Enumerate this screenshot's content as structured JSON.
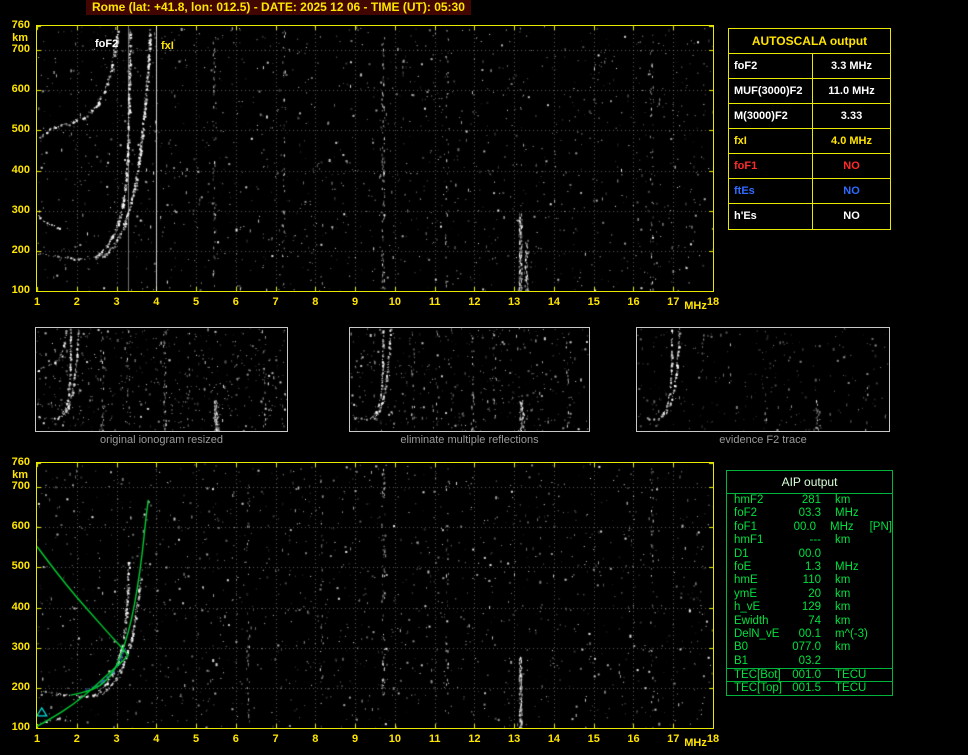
{
  "header": {
    "title": "Rome (lat: +41.8, lon: 012.5) - DATE: 2025 12 06 - TIME (UT): 05:30"
  },
  "autoscala_table": {
    "title": "AUTOSCALA output",
    "rows": [
      {
        "label": "foF2",
        "value": "3.3 MHz",
        "color": "#ffffff"
      },
      {
        "label": "MUF(3000)F2",
        "value": "11.0 MHz",
        "color": "#ffffff"
      },
      {
        "label": "M(3000)F2",
        "value": "3.33",
        "color": "#ffffff"
      },
      {
        "label": "fxI",
        "value": "4.0 MHz",
        "color": "#ffe400"
      },
      {
        "label": "foF1",
        "value": "NO",
        "color": "#ff2a2a"
      },
      {
        "label": "ftEs",
        "value": "NO",
        "color": "#2f6bff"
      },
      {
        "label": "h'Es",
        "value": "NO",
        "color": "#ffffff"
      }
    ]
  },
  "thumbnails": [
    {
      "caption": "original ionogram resized"
    },
    {
      "caption": "eliminate multiple reflections"
    },
    {
      "caption": "evidence F2 trace"
    }
  ],
  "aip_table": {
    "title": "AIP output",
    "rows": [
      {
        "name": "hmF2",
        "value": "281",
        "unit": "km",
        "extra": ""
      },
      {
        "name": "foF2",
        "value": "03.3",
        "unit": "MHz",
        "extra": ""
      },
      {
        "name": "foF1",
        "value": "00.0",
        "unit": "MHz",
        "extra": "[PN]"
      },
      {
        "name": "hmF1",
        "value": "---",
        "unit": "km",
        "extra": ""
      },
      {
        "name": "D1",
        "value": "00.0",
        "unit": "",
        "extra": ""
      },
      {
        "name": "foE",
        "value": "1.3",
        "unit": "MHz",
        "extra": ""
      },
      {
        "name": "hmE",
        "value": "110",
        "unit": "km",
        "extra": ""
      },
      {
        "name": "ymE",
        "value": "20",
        "unit": "km",
        "extra": ""
      },
      {
        "name": "h_vE",
        "value": "129",
        "unit": "km",
        "extra": ""
      },
      {
        "name": "Ewidth",
        "value": "74",
        "unit": "km",
        "extra": ""
      },
      {
        "name": "DelN_vE",
        "value": "00.1",
        "unit": "m^(-3)",
        "extra": ""
      },
      {
        "name": "B0",
        "value": "077.0",
        "unit": "km",
        "extra": ""
      },
      {
        "name": "B1",
        "value": "03.2",
        "unit": "",
        "extra": ""
      }
    ],
    "tec_rows": [
      {
        "name": "TEC[Bot]",
        "value": "001.0",
        "unit": "TECU"
      },
      {
        "name": "TEC[Top]",
        "value": "001.5",
        "unit": "TECU"
      }
    ]
  },
  "chart_data": [
    {
      "id": "scaled-ionogram",
      "type": "scatter",
      "title": "autoscaled ionogram with foF2 and fxI markers",
      "xlabel": "MHz",
      "ylabel": "km",
      "xlim": [
        1,
        18
      ],
      "ylim": [
        100,
        760
      ],
      "x_ticks": [
        1,
        2,
        3,
        4,
        5,
        6,
        7,
        8,
        9,
        10,
        11,
        12,
        13,
        14,
        15,
        16,
        17,
        18
      ],
      "y_ticks": [
        760,
        700,
        600,
        500,
        400,
        300,
        200,
        100
      ],
      "grid": true,
      "markers": [
        {
          "label": "foF2",
          "mhz": 3.3
        },
        {
          "label": "fxI",
          "mhz": 4.0
        }
      ],
      "series": [
        {
          "name": "F-trace-low",
          "points": [
            [
              1.05,
              195
            ],
            [
              1.35,
              188
            ],
            [
              1.7,
              183
            ],
            [
              2.05,
              181
            ],
            [
              2.35,
              182
            ],
            [
              2.55,
              186
            ]
          ]
        },
        {
          "name": "F-trace-onset",
          "points": [
            [
              1.0,
              292
            ],
            [
              1.15,
              276
            ],
            [
              1.35,
              265
            ],
            [
              1.55,
              259
            ]
          ]
        },
        {
          "name": "F2-ordinary",
          "points": [
            [
              2.45,
              183
            ],
            [
              2.75,
              212
            ],
            [
              2.95,
              248
            ],
            [
              3.1,
              292
            ],
            [
              3.2,
              350
            ],
            [
              3.27,
              430
            ],
            [
              3.3,
              530
            ],
            [
              3.32,
              650
            ],
            [
              3.33,
              756
            ]
          ]
        },
        {
          "name": "F2-extraordinary",
          "points": [
            [
              2.65,
              186
            ],
            [
              2.95,
              218
            ],
            [
              3.15,
              256
            ],
            [
              3.32,
              306
            ],
            [
              3.47,
              366
            ],
            [
              3.58,
              440
            ],
            [
              3.68,
              530
            ],
            [
              3.76,
              622
            ],
            [
              3.82,
              712
            ],
            [
              3.84,
              758
            ]
          ]
        },
        {
          "name": "second-reflection",
          "points": [
            [
              1.05,
              482
            ],
            [
              1.35,
              505
            ],
            [
              1.75,
              517
            ],
            [
              2.15,
              533
            ],
            [
              2.5,
              562
            ],
            [
              2.72,
              606
            ],
            [
              2.88,
              656
            ],
            [
              2.98,
              716
            ],
            [
              3.03,
              758
            ]
          ]
        }
      ],
      "rfi_stripes": [
        {
          "mhz": 5.45,
          "h0": 100,
          "h1": 750,
          "n": 60
        },
        {
          "mhz": 7.2,
          "h0": 100,
          "h1": 750,
          "n": 40
        },
        {
          "mhz": 9.7,
          "h0": 100,
          "h1": 750,
          "n": 90
        },
        {
          "mhz": 11.3,
          "h0": 100,
          "h1": 750,
          "n": 40
        },
        {
          "mhz": 13.15,
          "h0": 100,
          "h1": 300,
          "n": 150
        },
        {
          "mhz": 13.3,
          "h0": 100,
          "h1": 230,
          "n": 60
        },
        {
          "mhz": 16.45,
          "h0": 100,
          "h1": 750,
          "n": 45
        }
      ]
    },
    {
      "id": "profile-ionogram",
      "type": "scatter",
      "title": "ionogram with AIP electron density profile and model trace",
      "xlabel": "MHz",
      "ylabel": "km",
      "xlim": [
        1,
        18
      ],
      "ylim": [
        100,
        760
      ],
      "x_ticks": [
        1,
        2,
        3,
        4,
        5,
        6,
        7,
        8,
        9,
        10,
        11,
        12,
        13,
        14,
        15,
        16,
        17,
        18
      ],
      "y_ticks": [
        760,
        700,
        600,
        500,
        400,
        300,
        200,
        100
      ],
      "grid": true,
      "series": [
        {
          "name": "F-trace-low",
          "points": [
            [
              1.05,
              195
            ],
            [
              1.35,
              188
            ],
            [
              1.7,
              183
            ],
            [
              2.05,
              181
            ],
            [
              2.35,
              182
            ],
            [
              2.55,
              186
            ]
          ]
        },
        {
          "name": "F2-ordinary",
          "points": [
            [
              2.45,
              183
            ],
            [
              2.75,
              212
            ],
            [
              2.95,
              248
            ],
            [
              3.1,
              292
            ],
            [
              3.2,
              350
            ],
            [
              3.27,
              430
            ],
            [
              3.3,
              520
            ]
          ]
        },
        {
          "name": "F2-extraordinary",
          "points": [
            [
              2.65,
              186
            ],
            [
              2.95,
              218
            ],
            [
              3.15,
              256
            ],
            [
              3.32,
              306
            ],
            [
              3.45,
              366
            ],
            [
              3.55,
              430
            ],
            [
              3.6,
              478
            ]
          ]
        },
        {
          "name": "selected-F2-points",
          "color": "#4466ff",
          "points": [
            [
              2.2,
              196
            ],
            [
              2.55,
              210
            ],
            [
              2.85,
              236
            ],
            [
              3.05,
              264
            ],
            [
              3.2,
              300
            ]
          ]
        },
        {
          "name": "E-region-scatter",
          "points": [
            [
              1.0,
              112
            ],
            [
              1.3,
              118
            ],
            [
              1.6,
              124
            ],
            [
              1.85,
              118
            ]
          ]
        }
      ],
      "curves": [
        {
          "name": "bottomside-profile",
          "color": "#00cc33",
          "points": [
            [
              1.0,
              104
            ],
            [
              1.4,
              126
            ],
            [
              1.9,
              158
            ],
            [
              2.4,
              198
            ],
            [
              2.8,
              236
            ],
            [
              3.1,
              262
            ],
            [
              3.3,
              281
            ]
          ]
        },
        {
          "name": "topside-profile",
          "color": "#00cc33",
          "points": [
            [
              3.3,
              281
            ],
            [
              3.15,
              298
            ],
            [
              2.85,
              330
            ],
            [
              2.45,
              375
            ],
            [
              2.0,
              425
            ],
            [
              1.5,
              486
            ],
            [
              1.0,
              552
            ]
          ]
        },
        {
          "name": "model-trace",
          "color": "#00cc33",
          "points": [
            [
              1.85,
              182
            ],
            [
              2.3,
              190
            ],
            [
              2.7,
              212
            ],
            [
              3.0,
              252
            ],
            [
              3.2,
              305
            ],
            [
              3.38,
              370
            ],
            [
              3.52,
              445
            ],
            [
              3.65,
              535
            ],
            [
              3.74,
              625
            ],
            [
              3.8,
              668
            ]
          ]
        }
      ],
      "shapes": [
        {
          "type": "triangle",
          "mhz": 1.12,
          "km": 140,
          "color": "#00e0e0"
        }
      ],
      "rfi_stripes": [
        {
          "mhz": 6.3,
          "h0": 100,
          "h1": 750,
          "n": 40
        },
        {
          "mhz": 8.15,
          "h0": 100,
          "h1": 750,
          "n": 35
        },
        {
          "mhz": 9.7,
          "h0": 100,
          "h1": 750,
          "n": 70
        },
        {
          "mhz": 11.3,
          "h0": 100,
          "h1": 750,
          "n": 35
        },
        {
          "mhz": 13.15,
          "h0": 100,
          "h1": 280,
          "n": 130
        },
        {
          "mhz": 16.45,
          "h0": 100,
          "h1": 750,
          "n": 40
        }
      ]
    }
  ]
}
